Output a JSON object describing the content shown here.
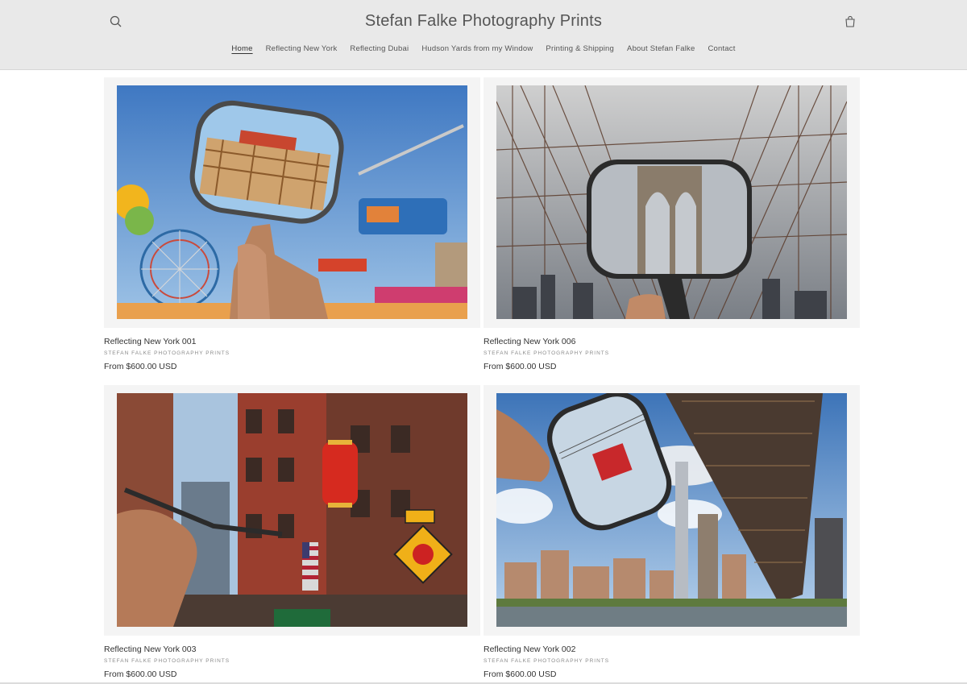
{
  "header": {
    "site_title": "Stefan Falke Photography Prints",
    "search_icon": "search-icon",
    "cart_icon": "cart-icon",
    "nav": [
      {
        "label": "Home",
        "active": true
      },
      {
        "label": "Reflecting New York",
        "active": false
      },
      {
        "label": "Reflecting Dubai",
        "active": false
      },
      {
        "label": "Hudson Yards from my Window",
        "active": false
      },
      {
        "label": "Printing & Shipping",
        "active": false
      },
      {
        "label": "About Stefan Falke",
        "active": false
      },
      {
        "label": "Contact",
        "active": false
      }
    ]
  },
  "products": [
    {
      "title": "Reflecting New York 001",
      "vendor": "STEFAN FALKE PHOTOGRAPHY PRINTS",
      "price": "From $600.00 USD"
    },
    {
      "title": "Reflecting New York 006",
      "vendor": "STEFAN FALKE PHOTOGRAPHY PRINTS",
      "price": "From $600.00 USD"
    },
    {
      "title": "Reflecting New York 003",
      "vendor": "STEFAN FALKE PHOTOGRAPHY PRINTS",
      "price": "From $600.00 USD"
    },
    {
      "title": "Reflecting New York 002",
      "vendor": "STEFAN FALKE PHOTOGRAPHY PRINTS",
      "price": "From $600.00 USD"
    }
  ],
  "colors": {
    "header_bg": "#e9e9e9",
    "text": "#333333",
    "muted": "#8a8a8a"
  }
}
